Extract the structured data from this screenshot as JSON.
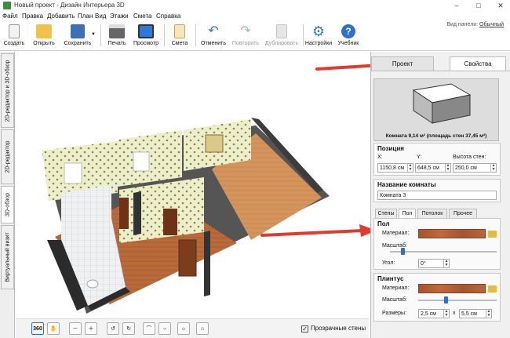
{
  "window": {
    "title": "Новый проект - Дизайн Интерьера 3D",
    "controls": [
      "–",
      "□",
      "✕"
    ]
  },
  "menu": [
    "Файл",
    "Правка",
    "Добавить",
    "План",
    "Вид",
    "Этажи",
    "Смета",
    "Справка"
  ],
  "panel_view": {
    "label": "Вид панели:",
    "value": "Обычный"
  },
  "toolbar": [
    {
      "label": "Создать",
      "icon": "new-document-icon",
      "enabled": true
    },
    {
      "label": "Открыть",
      "icon": "folder-open-icon",
      "enabled": true
    },
    {
      "label": "Сохранить",
      "icon": "floppy-disk-icon",
      "enabled": true
    },
    {
      "label": "Печать",
      "icon": "printer-icon",
      "enabled": true
    },
    {
      "label": "Просмотр",
      "icon": "monitor-icon",
      "enabled": true
    },
    {
      "label": "Смета",
      "icon": "estimate-notepad-icon",
      "enabled": true
    },
    {
      "label": "Отменить",
      "icon": "undo-icon",
      "enabled": true
    },
    {
      "label": "Повторить",
      "icon": "redo-icon",
      "enabled": false
    },
    {
      "label": "Дублировать",
      "icon": "duplicate-icon",
      "enabled": false
    },
    {
      "label": "Настройки",
      "icon": "gear-icon",
      "enabled": true
    },
    {
      "label": "Учебник",
      "icon": "help-icon",
      "enabled": true
    }
  ],
  "left_tabs": [
    "2D-редактор и 3D-обзор",
    "2D-редактор",
    "3D-обзор",
    "Виртуальный визит"
  ],
  "bottom": {
    "buttons": [
      "360",
      "hand",
      "zoom-out",
      "zoom-in",
      "rotate-left",
      "rotate-right",
      "tilt-up",
      "tilt-down",
      "light",
      "home"
    ],
    "transparent_walls_label": "Прозрачные стены",
    "transparent_walls_checked": true
  },
  "right_panel": {
    "tabs": [
      "Проект",
      "Свойства"
    ],
    "active_tab": "Свойства",
    "preview_caption": "Комната 9,14 м² (площадь стен 37,45 м²)",
    "position": {
      "title": "Позиция",
      "x_label": "X:",
      "x_value": "1150,8 см",
      "y_label": "Y:",
      "y_value": "648,5 см",
      "h_label": "Высота стен:",
      "h_value": "250,0 см"
    },
    "room_name": {
      "title": "Название комнаты",
      "value": "Комната 3"
    },
    "sub_tabs": [
      "Стены",
      "Пол",
      "Потолок",
      "Прочее"
    ],
    "active_sub_tab": "Пол",
    "floor": {
      "title": "Пол",
      "material_label": "Материал:",
      "scale_label": "Масштаб:",
      "scale_level": 0.12,
      "angle_label": "Угол:",
      "angle_value": "0°"
    },
    "baseboard": {
      "title": "Плинтус",
      "material_label": "Материал:",
      "scale_label": "Масштаб:",
      "scale_level": 0.35,
      "sizes_label": "Размеры:",
      "size1": "2,5 см",
      "times": "x",
      "size2": "5,5 см"
    }
  },
  "colors": {
    "accent": "#2f6fd0",
    "arrow": "#e23b2e",
    "wood": "#b5602f"
  }
}
